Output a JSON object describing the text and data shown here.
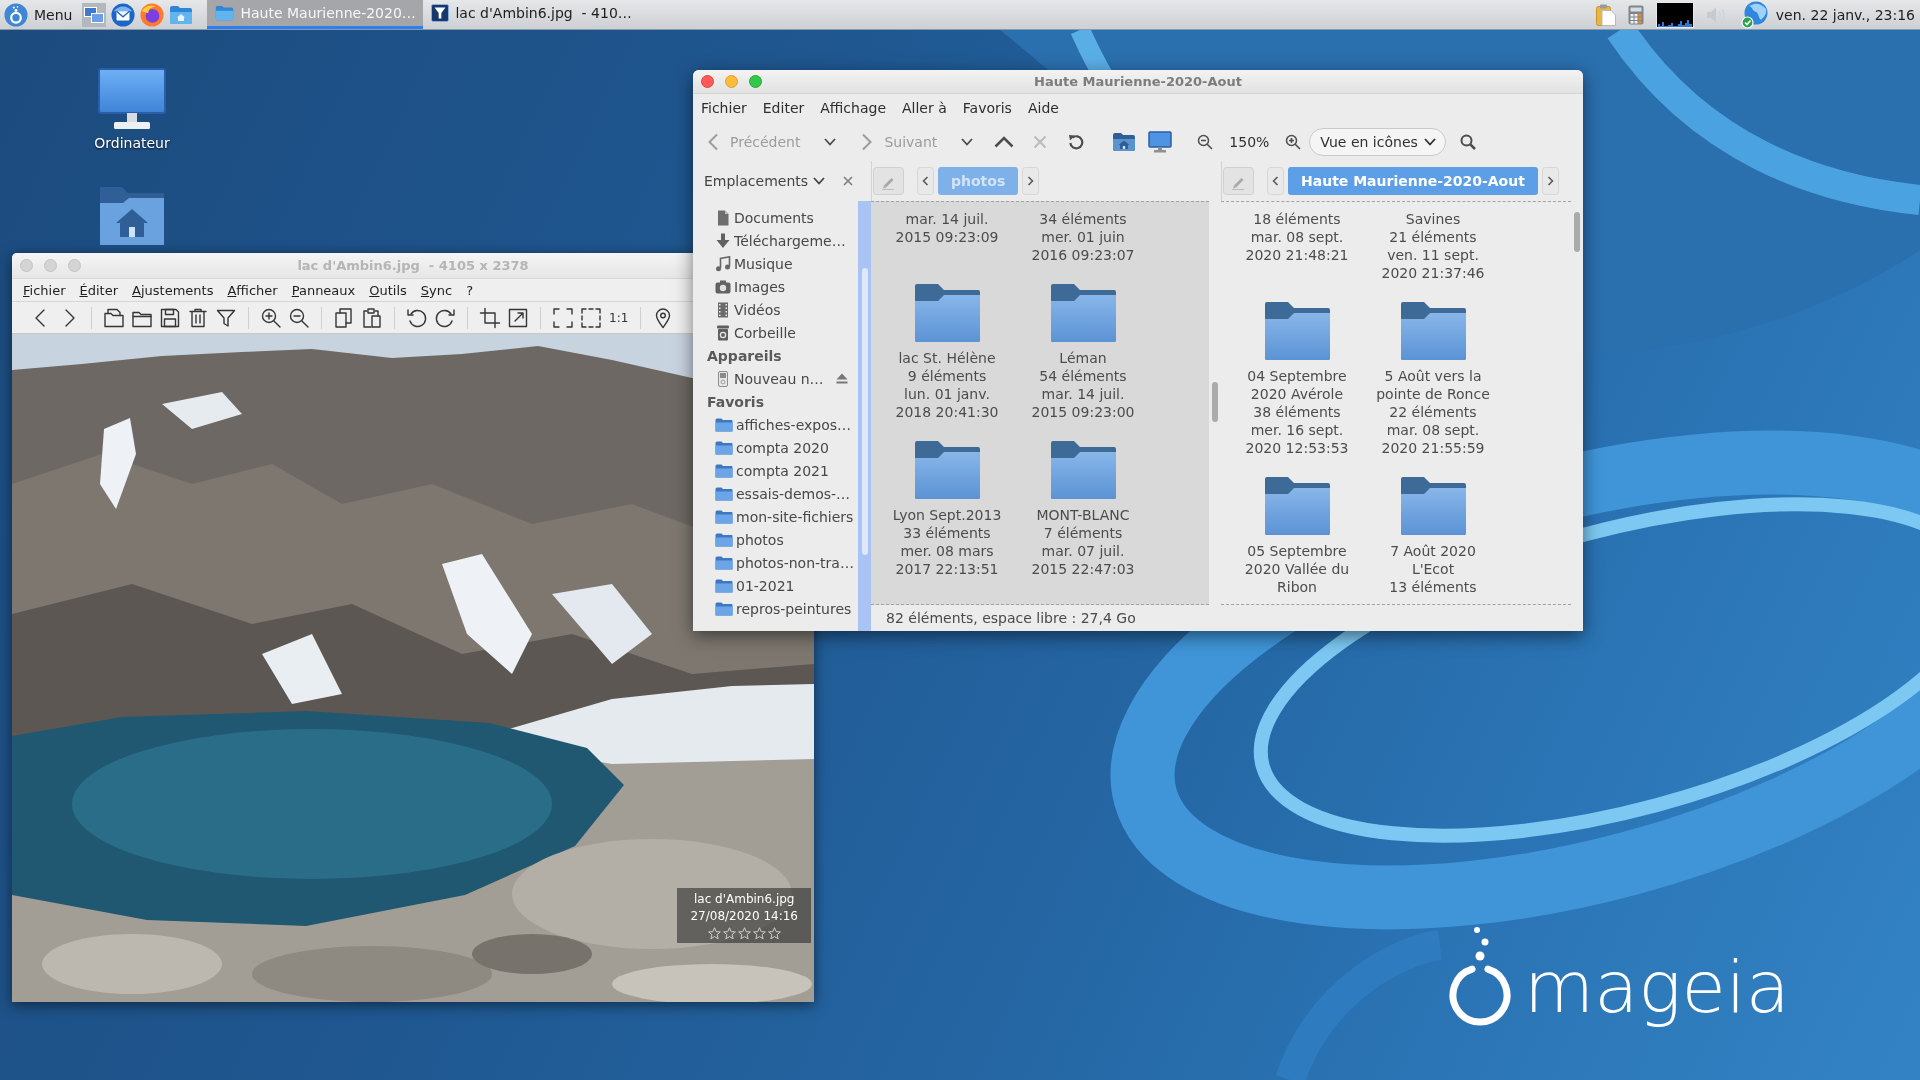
{
  "taskbar": {
    "menu": {
      "label": "Menu"
    },
    "launchers": [
      {
        "kind": "windows"
      },
      {
        "kind": "mail"
      },
      {
        "kind": "browser"
      },
      {
        "kind": "files"
      }
    ],
    "tasks": [
      {
        "kind": "files",
        "title": "Haute Maurienne-2020…",
        "selected": true
      },
      {
        "kind": "viewer",
        "title": "lac d'Ambin6.jpg  - 410…",
        "selected": false
      }
    ],
    "tray": [
      {
        "kind": "clipboard"
      },
      {
        "kind": "calculator"
      },
      {
        "kind": "load_graph"
      },
      {
        "kind": "volume"
      },
      {
        "kind": "network"
      }
    ],
    "clock": "ven. 22 janv., 23:16"
  },
  "desktop": {
    "icons": [
      {
        "kind": "computer",
        "label": "Ordinateur"
      },
      {
        "kind": "home"
      }
    ],
    "logo": {
      "text": "mageia"
    }
  },
  "viewer": {
    "active": false,
    "title": "lac d'Ambin6.jpg  - 4105 x 2378",
    "menu": {
      "underline_access_keys": true,
      "items": [
        "Fichier",
        "Éditer",
        "Ajustements",
        "Afficher",
        "Panneaux",
        "Outils",
        "Sync",
        "?"
      ]
    },
    "toolbar": [
      [
        {
          "kind": "previous"
        },
        {
          "kind": "next"
        }
      ],
      [
        {
          "kind": "open"
        },
        {
          "kind": "folder"
        },
        {
          "kind": "save"
        },
        {
          "kind": "delete"
        },
        {
          "kind": "filter"
        }
      ],
      [
        {
          "kind": "zoom_in"
        },
        {
          "kind": "zoom_out"
        }
      ],
      [
        {
          "kind": "copy"
        },
        {
          "kind": "paste"
        }
      ],
      [
        {
          "kind": "rotate_left"
        },
        {
          "kind": "rotate_right"
        }
      ],
      [
        {
          "kind": "crop"
        },
        {
          "kind": "resize"
        }
      ],
      [
        {
          "kind": "fullscreen"
        },
        {
          "kind": "fit"
        },
        {
          "kind": "text",
          "label": "1:1"
        }
      ],
      [
        {
          "kind": "location"
        }
      ]
    ],
    "overlay": {
      "filename": "lac d'Ambin6.jpg",
      "datetime": "27/08/2020 14:16",
      "stars": 0
    }
  },
  "files": {
    "active": true,
    "title": "Haute Maurienne-2020-Aout",
    "menu": [
      "Fichier",
      "Editer",
      "Affichage",
      "Aller à",
      "Favoris",
      "Aide"
    ],
    "toolbar": [
      {
        "kind": "back",
        "label": "Précédent",
        "disabled": true
      },
      {
        "kind": "history",
        "disabled": false
      },
      {
        "kind": "forward",
        "label": "Suivant",
        "disabled": true
      },
      {
        "kind": "history",
        "disabled": false
      },
      {
        "kind": "up",
        "disabled": false
      },
      {
        "kind": "stop",
        "disabled": true
      },
      {
        "kind": "reload",
        "disabled": false
      },
      {
        "kind": "home",
        "disabled": false
      },
      {
        "kind": "computer",
        "disabled": false
      },
      {
        "kind": "zoom_out",
        "disabled": false
      },
      {
        "kind": "zoom_level",
        "label": "150%"
      },
      {
        "kind": "zoom_in",
        "disabled": false
      },
      {
        "kind": "view_mode",
        "label": "Vue en icônes"
      },
      {
        "kind": "search",
        "disabled": false
      }
    ],
    "sidebar": {
      "title": "Emplacements",
      "sections": [
        {
          "items": [
            {
              "kind": "document",
              "label": "Documents"
            },
            {
              "kind": "download",
              "label": "Téléchargeme…"
            },
            {
              "kind": "music",
              "label": "Musique"
            },
            {
              "kind": "camera",
              "label": "Images"
            },
            {
              "kind": "film",
              "label": "Vidéos"
            },
            {
              "kind": "trash",
              "label": "Corbeille"
            }
          ]
        },
        {
          "heading": "Appareils",
          "items": [
            {
              "kind": "drive",
              "label": "Nouveau n…"
            }
          ]
        },
        {
          "heading": "Favoris",
          "items": [
            {
              "kind": "folder",
              "label": "affiches-expos…"
            },
            {
              "kind": "folder",
              "label": "compta 2020"
            },
            {
              "kind": "folder",
              "label": "compta 2021"
            },
            {
              "kind": "folder",
              "label": "essais-demos-…"
            },
            {
              "kind": "folder",
              "label": "mon-site-fichiers"
            },
            {
              "kind": "folder",
              "label": "photos"
            },
            {
              "kind": "folder",
              "label": "photos-non-tra…"
            },
            {
              "kind": "folder",
              "label": "01-2021"
            },
            {
              "kind": "folder",
              "label": "repros-peintures"
            }
          ]
        }
      ]
    },
    "panes": [
      {
        "active": false,
        "path": "photos",
        "items": [
          {
            "kind": "tail",
            "date": "mar. 14 juil. 2015 09:23:09"
          },
          {
            "kind": "tail",
            "count": "34 éléments",
            "date": "mer. 01 juin 2016 09:23:07"
          },
          {
            "kind": "folder",
            "name": "lac St. Hélène",
            "count": "9 éléments",
            "date": "lun. 01 janv. 2018 20:41:30"
          },
          {
            "kind": "folder",
            "name": "Léman",
            "count": "54 éléments",
            "date": "mar. 14 juil. 2015 09:23:00"
          },
          {
            "kind": "folder",
            "name": "Lyon Sept.2013",
            "count": "33 éléments",
            "date": "mer. 08 mars 2017 22:13:51"
          },
          {
            "kind": "folder",
            "name": "MONT-BLANC",
            "count": "7 éléments",
            "date": "mar. 07 juil. 2015 22:47:03"
          }
        ],
        "status": "82 éléments, espace libre : 27,4 Go"
      },
      {
        "active": true,
        "path": "Haute Maurienne-2020-Aout",
        "items": [
          {
            "kind": "tail",
            "count": "18 éléments",
            "date": "mar. 08 sept. 2020 21:48:21"
          },
          {
            "kind": "tail",
            "name": "Savines",
            "count": "21 éléments",
            "date": "ven. 11 sept. 2020 21:37:46"
          },
          {
            "kind": "folder",
            "name": "04 Septembre 2020 Avérole",
            "count": "38 éléments",
            "date": "mer. 16 sept. 2020 12:53:53"
          },
          {
            "kind": "folder",
            "name": "5 Août vers la pointe de Ronce",
            "count": "22 éléments",
            "date": "mar. 08 sept. 2020 21:55:59"
          },
          {
            "kind": "folder",
            "name": "05 Septembre 2020 Vallée du Ribon"
          },
          {
            "kind": "folder",
            "name": "7 Août 2020 L'Ecot",
            "count": "13 éléments"
          }
        ]
      }
    ]
  }
}
